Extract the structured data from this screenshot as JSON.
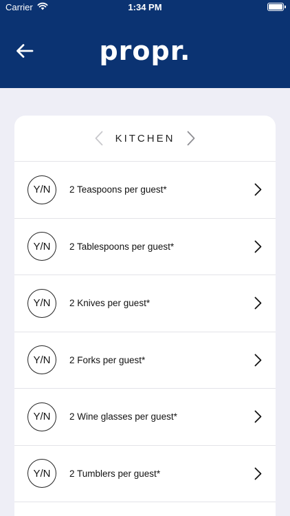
{
  "status": {
    "carrier": "Carrier",
    "time": "1:34 PM",
    "wifi_icon": "wifi-icon",
    "battery_icon": "battery-icon"
  },
  "header": {
    "logo": "propr.",
    "back_icon": "arrow-left-icon",
    "background": "#0b3372"
  },
  "section": {
    "title": "KITCHEN",
    "prev_icon": "chevron-left-icon",
    "next_icon": "chevron-right-icon"
  },
  "items": [
    {
      "badge": "Y/N",
      "label": "2 Teaspoons per guest*"
    },
    {
      "badge": "Y/N",
      "label": "2 Tablespoons per guest*"
    },
    {
      "badge": "Y/N",
      "label": "2 Knives per guest*"
    },
    {
      "badge": "Y/N",
      "label": "2 Forks per guest*"
    },
    {
      "badge": "Y/N",
      "label": "2 Wine glasses per guest*"
    },
    {
      "badge": "Y/N",
      "label": "2 Tumblers per guest*"
    }
  ]
}
